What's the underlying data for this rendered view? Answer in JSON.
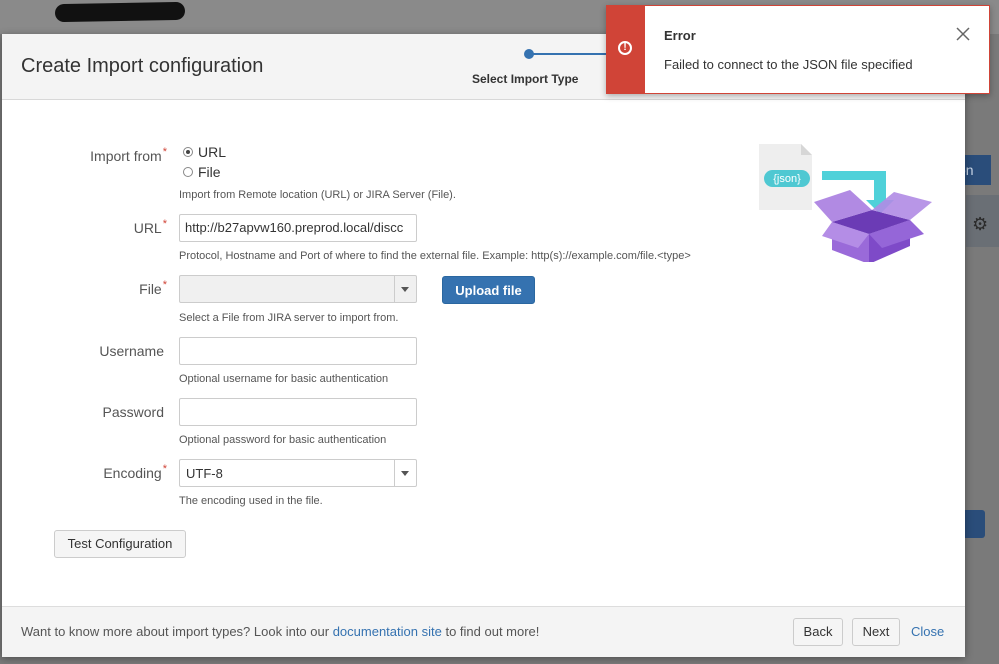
{
  "background": {
    "side_button_1": "on",
    "side_button_2": "g"
  },
  "dialog": {
    "title": "Create Import configuration",
    "step_label": "Select Import Type"
  },
  "form": {
    "import_from": {
      "label": "Import from",
      "options": [
        "URL",
        "File"
      ],
      "selected": "URL",
      "help": "Import from Remote location (URL) or JIRA Server (File)."
    },
    "url": {
      "label": "URL",
      "value": "http://b27apvw160.preprod.local/discc",
      "help": "Protocol, Hostname and Port of where to find the external file. Example: http(s)://example.com/file.<type>"
    },
    "file": {
      "label": "File",
      "value": "",
      "upload_label": "Upload file",
      "help": "Select a File from JIRA server to import from."
    },
    "username": {
      "label": "Username",
      "value": "",
      "help": "Optional username for basic authentication"
    },
    "password": {
      "label": "Password",
      "value": "",
      "help": "Optional password for basic authentication"
    },
    "encoding": {
      "label": "Encoding",
      "value": "UTF-8",
      "help": "The encoding used in the file."
    },
    "test_button": "Test Configuration"
  },
  "illustration": {
    "file_badge": "{json}"
  },
  "footer": {
    "text_before": "Want to know more about import types? Look into our",
    "link": "documentation site",
    "text_after": "to find out more!",
    "back": "Back",
    "next": "Next",
    "close": "Close"
  },
  "flag": {
    "title": "Error",
    "message": "Failed to connect to the JSON file specified"
  },
  "colors": {
    "primary": "#3572b0",
    "error": "#d04437",
    "illustration_purple": "#8d5bd6",
    "illustration_teal": "#4fd1d9"
  }
}
